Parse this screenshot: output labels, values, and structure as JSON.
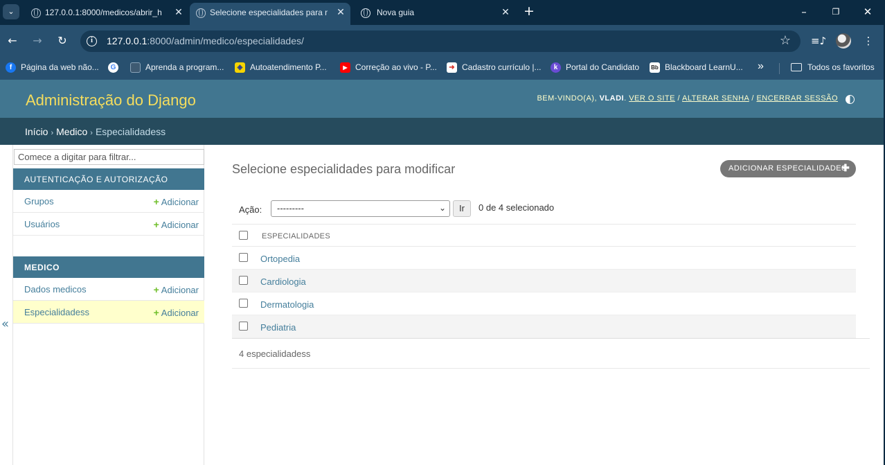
{
  "browser": {
    "tabs": [
      {
        "title": "127.0.0.1:8000/medicos/abrir_h",
        "active": false
      },
      {
        "title": "Selecione especialidades para m",
        "active": true
      },
      {
        "title": "Nova guia",
        "active": false
      }
    ],
    "url_host": "127.0.0.1",
    "url_rest": ":8000/admin/medico/especialidades/",
    "bookmarks": [
      {
        "label": "Página da web não...",
        "icon": "facebook-icon",
        "color": "#1877f2"
      },
      {
        "label": "",
        "icon": "google-icon",
        "color": "#ffffff"
      },
      {
        "label": "Aprenda a program...",
        "icon": "page-icon",
        "color": "#5a6b7a"
      },
      {
        "label": "Autoatendimento P...",
        "icon": "bank-icon",
        "color": "#f5d400"
      },
      {
        "label": "Correção ao vivo - P...",
        "icon": "youtube-icon",
        "color": "#ff0000"
      },
      {
        "label": "Cadastro currículo |...",
        "icon": "login-icon",
        "color": "#d9342b"
      },
      {
        "label": "Portal do Candidato",
        "icon": "k-icon",
        "color": "#6a4cd4"
      },
      {
        "label": "Blackboard LearnU...",
        "icon": "blackboard-icon",
        "color": "#222222"
      }
    ],
    "all_bookmarks_label": "Todos os favoritos"
  },
  "header": {
    "brand": "Administração do Django",
    "welcome": "Bem-vindo(a),",
    "username": "vladi",
    "view_site": "Ver o site",
    "change_password": "Alterar senha",
    "logout": "Encerrar sessão"
  },
  "breadcrumbs": {
    "home": "Início",
    "app": "Medico",
    "current": "Especialidadess"
  },
  "sidebar": {
    "filter_placeholder": "Comece a digitar para filtrar...",
    "modules": [
      {
        "caption": "Autenticação e Autorização",
        "models": [
          {
            "name": "Grupos",
            "add": "Adicionar"
          },
          {
            "name": "Usuários",
            "add": "Adicionar"
          }
        ]
      },
      {
        "caption": "Medico",
        "models": [
          {
            "name": "Dados medicos",
            "add": "Adicionar"
          },
          {
            "name": "Especialidadess",
            "add": "Adicionar"
          }
        ]
      }
    ],
    "collapse_symbol": "«"
  },
  "content": {
    "title": "Selecione especialidades para modificar",
    "add_button": "Adicionar especialidades",
    "action_label": "Ação:",
    "action_selected": "---------",
    "go_button": "Ir",
    "counter": "0 de 4 selecionado",
    "column_header": "Especialidades",
    "rows": [
      "Ortopedia",
      "Cardiologia",
      "Dermatologia",
      "Pediatria"
    ],
    "paginator": "4 especialidadess"
  },
  "colors": {
    "header": "#417690",
    "breadcrumbs": "#264b5d",
    "brand": "#f5dd5d",
    "link": "#447e9b",
    "add_plus": "#70bf2b",
    "current_row": "#ffffcc"
  }
}
